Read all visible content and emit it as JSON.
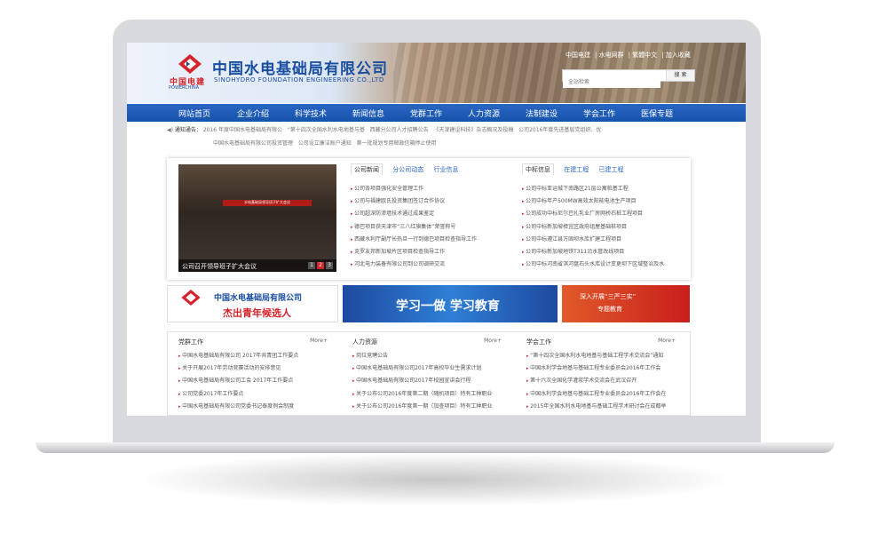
{
  "header": {
    "company_cn": "中国水电基础局有限公司",
    "company_en": "SINOHYDRO FOUNDATION ENGINEERING CO.,LTD",
    "logo_cn": "中国电建",
    "logo_en": "POWERCHINA",
    "top_links": [
      "中国电建",
      "水电网群",
      "繁體中文",
      "加入收藏"
    ],
    "search_placeholder": "全站检索",
    "search_button": "搜 索"
  },
  "nav": [
    "网站首页",
    "企业介绍",
    "科学技术",
    "新闻信息",
    "党群工作",
    "人力资源",
    "法制建设",
    "学会工作",
    "医保专题"
  ],
  "notice": {
    "label": "通知通告：",
    "items": [
      "2016 年度中国水电基础局有限公",
      "“第十四次全国水利水电地基与基",
      "西藏分公司人才招聘公告",
      "《天津建设科技》杂志概况及投稿",
      "公司2016年度先进基层党组织、优"
    ],
    "sub_items": [
      "中国水电基础局有限公司投资管理",
      "公司设立廉洁账户通知",
      "第一批规划专用邮政信箱停止使用"
    ]
  },
  "photo": {
    "banner": "水电基础局领导班子扩大会议",
    "caption": "公司召开领导班子扩大会议",
    "dots": [
      "1",
      "2",
      "3"
    ]
  },
  "news": {
    "tabs": [
      "公司新闻",
      "分公司动态",
      "行业信息"
    ],
    "items": [
      "公司各项目强化安全管理工作",
      "公司与福建欧氏投资集团签订合作协议",
      "公司超深防渗墙技术通过成果鉴定",
      "德巴项目获天津市“三八红旗集体”荣誉称号",
      "西藏水利厅副厅长热旦一行到德巴项目检查指导工作",
      "克罗友邦新加坡片区项目检查指导工作",
      "河北电力装备有限公司到公司调研交流"
    ]
  },
  "bids": {
    "tabs": [
      "中标信息",
      "在建工程",
      "已建工程"
    ],
    "items": [
      "公司中标亚运城下南路区21层公寓桩基工程",
      "公司中标年产500MW高效太阳能电池生产项目",
      "公司成功中标尼尔巴扎乳业厂房网桥石桩工程项目",
      "公司中标新加坡樟宜区政府组屋基础桩项目",
      "公司中标遵江县万固坝水库扩建工程项目",
      "公司中标新加坡地铁T311沿水管改线项目",
      "公司中标河南省淇河盘石头水库设计变更坝下区域整治及水"
    ]
  },
  "banners": {
    "b1_title": "中国水电基础局有限公司",
    "b1_sub": "杰出青年候选人",
    "b2": "学习一做 学习教育",
    "b3_title": "深入开展“三严三实”",
    "b3_sub": "专题教育"
  },
  "columns": [
    {
      "title": "党群工作",
      "more": "More+",
      "items": [
        "中国水电基础局有限公司 2017年共青团工作要点",
        "关于开展2017年劳动竞赛活动的安排意见",
        "中国水电基础局有限公司工会 2017年工作要点",
        "公司党委2017年工作要点",
        "中国水电基础局有限公司党委书记泰度例会制度"
      ]
    },
    {
      "title": "人力资源",
      "more": "More+",
      "items": [
        "岗位竞聘公告",
        "中国水电基础局有限公司2017年高校毕业生需求计划",
        "中国水电基础局有限公司2017年校园宣讲会行程",
        "关于公布公司2016年度第二期（随机项目）特有工种职业",
        "关于公布公司2016年度第一期（加查项目）特有工种职业"
      ]
    },
    {
      "title": "学会工作",
      "more": "More+",
      "items": [
        "“第十四次全国水利水电地基与基础工程学术交流会”通知",
        "中国水利学会地基与基础工程专业委员会2016年工作会",
        "第十六次全国化学灌浆学术交流会在武汉召开",
        "中国水利学会地基与基础工程专业委员会2016年工作会在",
        "2015年全国水利水电地基与基础工程学术研讨会在成都举"
      ]
    }
  ]
}
